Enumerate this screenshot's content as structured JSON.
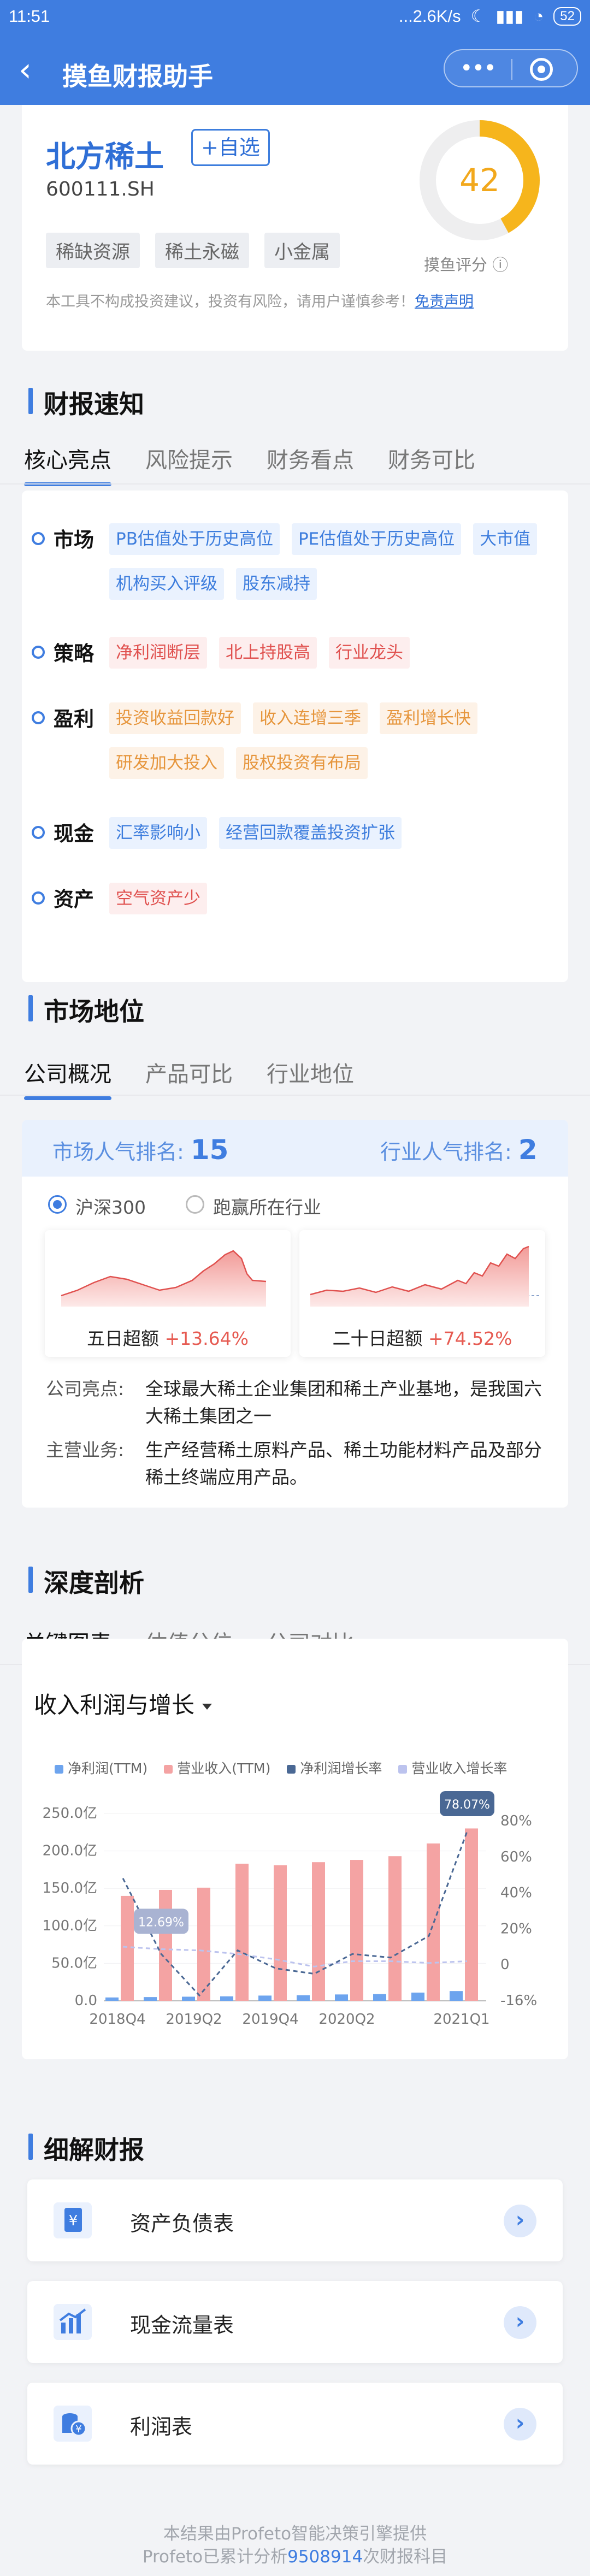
{
  "status_bar": {
    "time": "11:51",
    "network": "...2.6K/s",
    "battery": "52"
  },
  "nav": {
    "title": "摸鱼财报助手"
  },
  "stock": {
    "name": "北方稀土",
    "code": "600111.SH",
    "add_label": "+自选",
    "tags": [
      "稀缺资源",
      "稀土永磁",
      "小金属"
    ],
    "score": 42,
    "score_fraction": 0.42,
    "score_label": "摸鱼评分",
    "disclaimer_text": "本工具不构成投资建议，投资有风险，请用户谨慎参考！",
    "disclaimer_link": "免责声明",
    "colors": {
      "accent": "#3f7de0",
      "score": "#f6b51c"
    }
  },
  "report": {
    "title": "财报速知",
    "tabs": [
      "核心亮点",
      "风险提示",
      "财务看点",
      "财务可比"
    ],
    "highlights": [
      {
        "name": "市场",
        "chips": [
          {
            "text": "PB估值处于历史高位",
            "color": "blue"
          },
          {
            "text": "PE估值处于历史高位",
            "color": "blue"
          },
          {
            "text": "大市值",
            "color": "blue"
          },
          {
            "text": "机构买入评级",
            "color": "blue"
          },
          {
            "text": "股东减持",
            "color": "blue"
          }
        ]
      },
      {
        "name": "策略",
        "chips": [
          {
            "text": "净利润断层",
            "color": "red"
          },
          {
            "text": "北上持股高",
            "color": "red"
          },
          {
            "text": "行业龙头",
            "color": "red"
          }
        ]
      },
      {
        "name": "盈利",
        "chips": [
          {
            "text": "投资收益回款好",
            "color": "orange"
          },
          {
            "text": "收入连增三季",
            "color": "orange"
          },
          {
            "text": "盈利增长快",
            "color": "orange"
          },
          {
            "text": "研发加大投入",
            "color": "orange"
          },
          {
            "text": "股权投资有布局",
            "color": "orange"
          }
        ]
      },
      {
        "name": "现金",
        "chips": [
          {
            "text": "汇率影响小",
            "color": "blue"
          },
          {
            "text": "经营回款覆盖投资扩张",
            "color": "blue"
          }
        ]
      },
      {
        "name": "资产",
        "chips": [
          {
            "text": "空气资产少",
            "color": "red"
          }
        ]
      }
    ]
  },
  "market": {
    "title": "市场地位",
    "tabs": [
      "公司概况",
      "产品可比",
      "行业地位"
    ],
    "market_rank_label": "市场人气排名:",
    "market_rank": "15",
    "industry_rank_label": "行业人气排名:",
    "industry_rank": "2",
    "radio_options": [
      "沪深300",
      "跑赢所在行业"
    ],
    "five_day_label": "五日超额",
    "five_day_value": "+13.64%",
    "twenty_day_label": "二十日超额",
    "twenty_day_value": "+74.52%",
    "highlight_key": "公司亮点:",
    "highlight_value": "全球最大稀土企业集团和稀土产业基地，是我国六大稀土集团之一",
    "business_key": "主营业务:",
    "business_value": "生产经营稀土原料产品、稀土功能材料产品及部分稀土终端应用产品。"
  },
  "analysis": {
    "title": "深度剖析",
    "tabs": [
      "关键图表",
      "估值分位",
      "公司对比"
    ],
    "chart_select": "收入利润与增长"
  },
  "chart_data": {
    "type": "bar",
    "series_colors": {
      "net_profit": "#6da4ee",
      "revenue": "#f4a3a3",
      "net_growth": "#4a6894",
      "rev_growth": "#bcc3ee"
    },
    "legend": [
      "净利润(TTM)",
      "营业收入(TTM)",
      "净利润增长率",
      "营业收入增长率"
    ],
    "x_tick_labels": [
      "2018Q4",
      "2019Q2",
      "2019Q4",
      "2020Q2",
      "2021Q1"
    ],
    "y_left_ticks": [
      "250.0亿",
      "200.0亿",
      "150.0亿",
      "100.0亿",
      "50.0亿",
      "0.0"
    ],
    "y_right_ticks": [
      "80%",
      "60%",
      "40%",
      "20%",
      "0",
      "-16%"
    ],
    "ylim_left": [
      0,
      250
    ],
    "ylim_right": [
      -16,
      88
    ],
    "net_profit": [
      4.5,
      5.0,
      5.5,
      6.0,
      7.0,
      7.5,
      8.5,
      9.0,
      11.0,
      13.0
    ],
    "revenue": [
      140,
      148,
      151,
      183,
      181,
      185,
      188,
      193,
      210,
      230
    ],
    "net_growth": [
      52,
      10,
      -13,
      12,
      2,
      -1,
      10,
      8,
      20,
      78
    ],
    "rev_growth": [
      14,
      12.69,
      12,
      10,
      7,
      3,
      6,
      6,
      5,
      6
    ],
    "annotations": [
      {
        "text": "12.69%"
      },
      {
        "text": "78.07%"
      }
    ]
  },
  "details": {
    "title": "细解财报",
    "rows": [
      {
        "label": "资产负债表"
      },
      {
        "label": "现金流量表"
      },
      {
        "label": "利润表"
      }
    ]
  },
  "footer": {
    "line1": "本结果由Profeto智能决策引擎提供",
    "line2_prefix": "Profeto已累计分析",
    "count": "9508914",
    "line2_suffix": "次财报科目"
  }
}
